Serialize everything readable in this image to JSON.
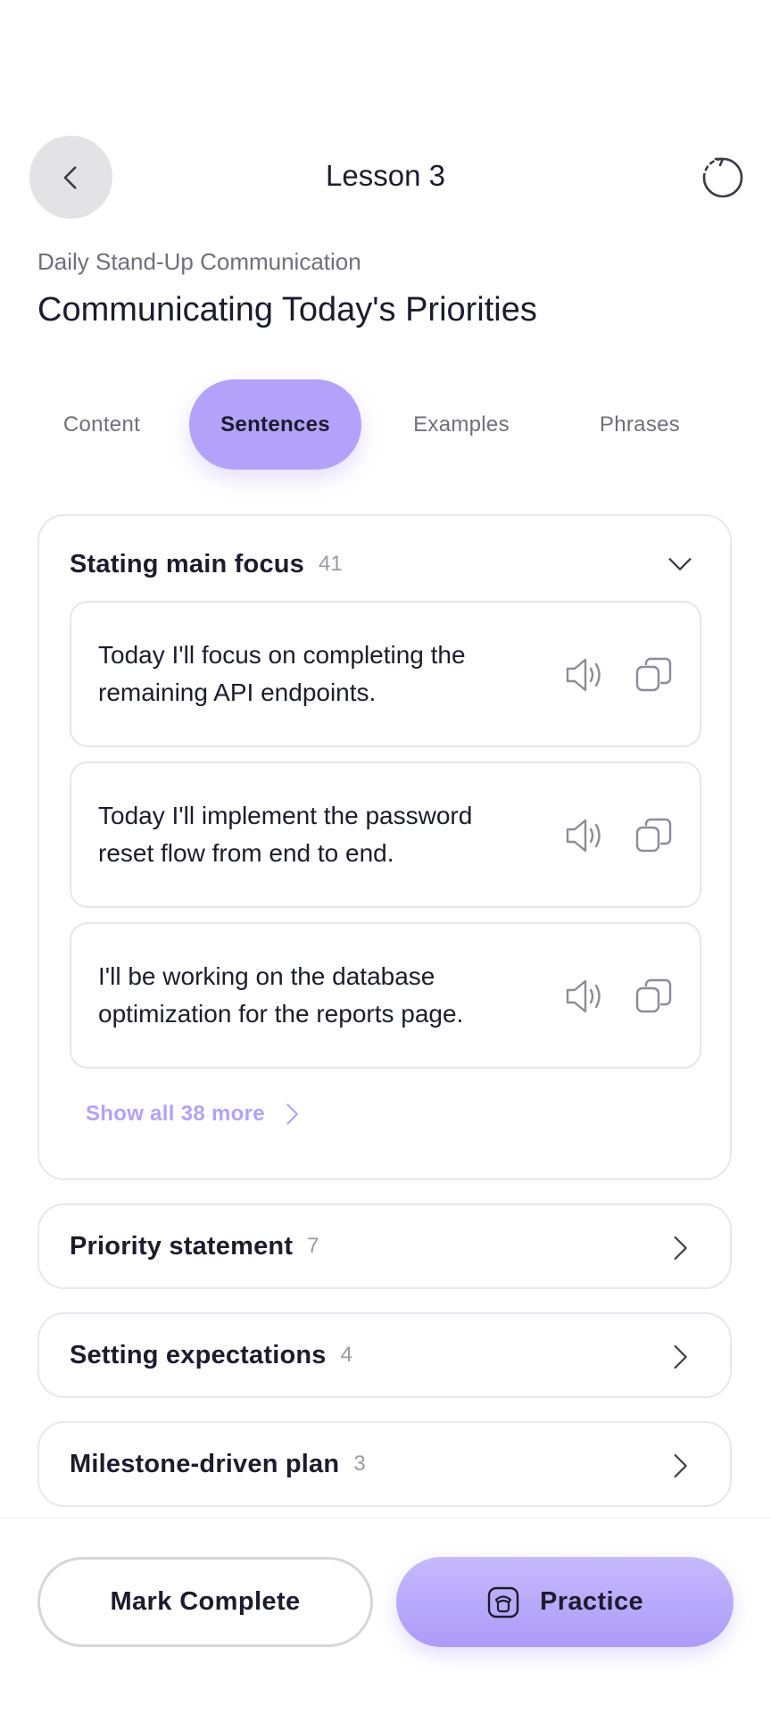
{
  "header": {
    "title": "Lesson 3",
    "back_icon": "chevron-left-icon",
    "reset_icon": "reset-icon"
  },
  "lesson": {
    "course_name": "Daily Stand-Up Communication",
    "title": "Communicating Today's Priorities"
  },
  "tabs": [
    {
      "label": "Content",
      "active": false
    },
    {
      "label": "Sentences",
      "active": true
    },
    {
      "label": "Examples",
      "active": false
    },
    {
      "label": "Phrases",
      "active": false
    }
  ],
  "groups": {
    "open": {
      "label": "Stating main focus",
      "count": "41",
      "sentences": [
        {
          "text": "Today I'll focus on completing the remaining API endpoints."
        },
        {
          "text": "Today I'll implement the password reset flow from end to end."
        },
        {
          "text": "I'll be working on the database optimization for the reports page."
        }
      ],
      "show_more": "Show all 38 more"
    },
    "collapsed": [
      {
        "label": "Priority statement",
        "count": "7"
      },
      {
        "label": "Setting expectations",
        "count": "4"
      },
      {
        "label": "Milestone-driven plan",
        "count": "3"
      }
    ]
  },
  "actions": {
    "mark_complete": "Mark Complete",
    "practice": "Practice"
  },
  "colors": {
    "accent": "#b2a2fa",
    "text": "#1c1c2e",
    "muted": "#6f6f7d"
  }
}
